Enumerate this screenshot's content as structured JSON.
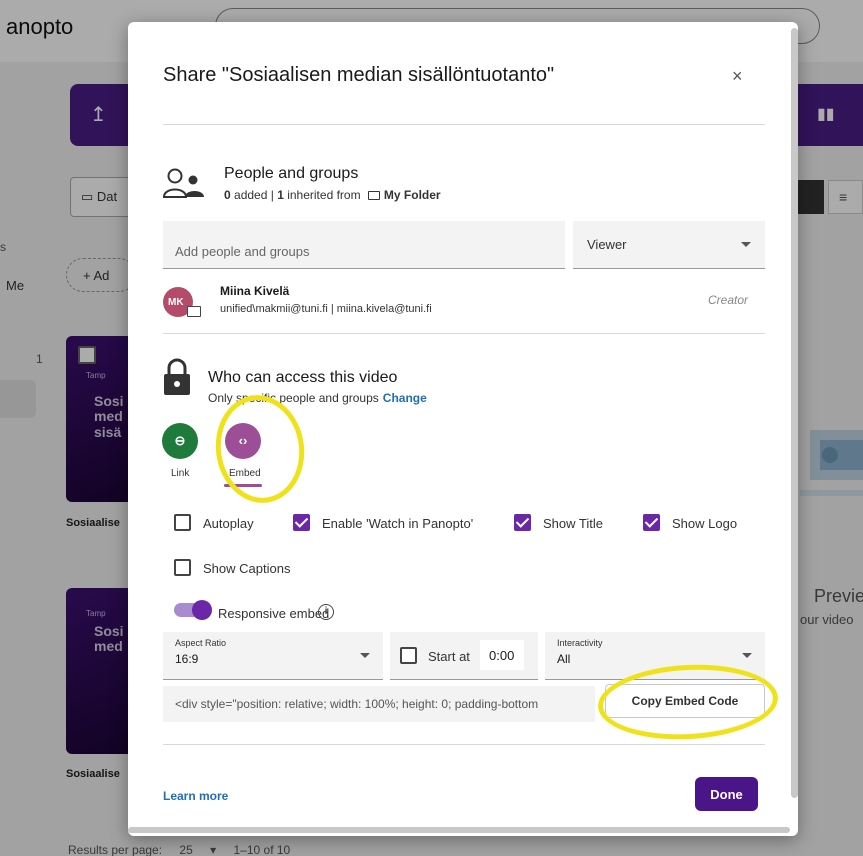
{
  "background": {
    "app_name": "anopto",
    "date_button": "Dat",
    "add_button": "Ad",
    "side_text_1": "s",
    "side_text_2": "Me",
    "side_count": "1",
    "thumb_tag": "Tamp",
    "thumb1_title": "Sosi med sisä",
    "thumb2_title": "Sosi med",
    "item_title_1": "Sosiaalise",
    "item_title_2": "Sosiaalise",
    "preview_title": "Previe",
    "preview_sub": "our video",
    "footer_label": "Results per page:",
    "footer_per_page": "25",
    "footer_range": "1–10 of 10"
  },
  "modal": {
    "title": "Share \"Sosiaalisen median sisällöntuotanto\"",
    "close": "×",
    "people": {
      "title": "People and groups",
      "added_count": "0",
      "added_label": " added",
      "separator": " | ",
      "inherited_count": "1",
      "inherited_label": " inherited from ",
      "folder_name": "My Folder"
    },
    "add_input": {
      "placeholder": "Add people and groups"
    },
    "role_select": {
      "value": "Viewer"
    },
    "user": {
      "initials": "MK",
      "name": "Miina Kivelä",
      "emails": "unified\\makmii@tuni.fi | miina.kivela@tuni.fi",
      "role": "Creator"
    },
    "access": {
      "title": "Who can access this video",
      "subtitle": "Only specific people and groups",
      "change": "Change"
    },
    "modes": {
      "link_label": "Link",
      "embed_label": "Embed",
      "link_glyph": "⊖",
      "embed_glyph": "‹›",
      "selected": "Embed"
    },
    "options": {
      "autoplay": {
        "label": "Autoplay",
        "checked": false
      },
      "watch_in_panopto": {
        "label": "Enable 'Watch in Panopto'",
        "checked": true
      },
      "show_title": {
        "label": "Show Title",
        "checked": true
      },
      "show_logo": {
        "label": "Show Logo",
        "checked": true
      },
      "show_captions": {
        "label": "Show Captions",
        "checked": false
      }
    },
    "responsive": {
      "label": "Responsive embed",
      "enabled": true,
      "info": "i"
    },
    "aspect_ratio": {
      "label": "Aspect Ratio",
      "value": "16:9"
    },
    "start_at": {
      "label": "Start at",
      "value": "0:00",
      "checked": false
    },
    "interactivity": {
      "label": "Interactivity",
      "value": "All"
    },
    "embed_code": "<div style=\"position: relative; width: 100%; height: 0; padding-bottom",
    "copy_button": "Copy Embed Code",
    "learn_more": "Learn more",
    "done_button": "Done"
  },
  "colors": {
    "brand_purple": "#4a1588",
    "checkbox_purple": "#6a28a8",
    "link_green": "#1e7b3c",
    "embed_purple": "#9c4f96",
    "annotation_yellow": "#f0e21a",
    "link_blue": "#1f6fb2"
  }
}
